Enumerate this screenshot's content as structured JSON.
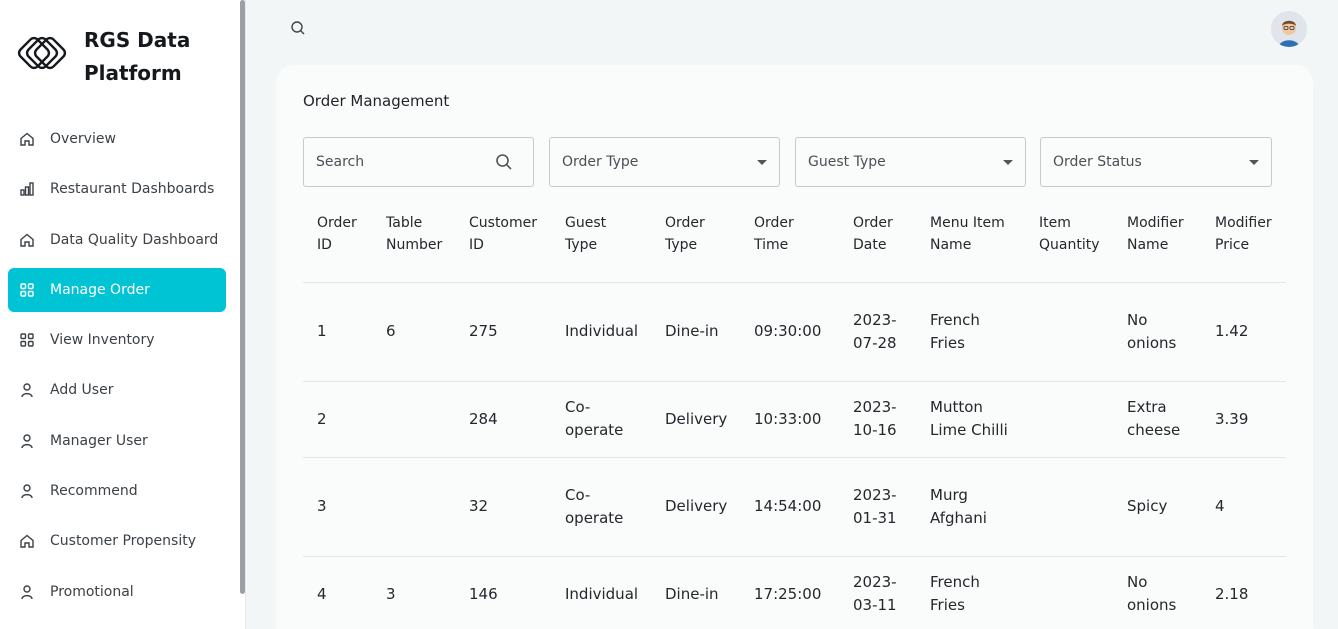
{
  "brand": {
    "line1": "RGS Data",
    "line2": "Platform"
  },
  "nav": [
    {
      "label": "Overview",
      "icon": "home-icon"
    },
    {
      "label": "Restaurant Dashboards",
      "icon": "bar-chart-icon"
    },
    {
      "label": "Data Quality Dashboard",
      "icon": "home-icon"
    },
    {
      "label": "Manage Order",
      "icon": "grid-icon",
      "active": true
    },
    {
      "label": "View Inventory",
      "icon": "grid-icon"
    },
    {
      "label": "Add User",
      "icon": "user-icon"
    },
    {
      "label": "Manager User",
      "icon": "user-icon"
    },
    {
      "label": "Recommend",
      "icon": "user-icon"
    },
    {
      "label": "Customer Propensity",
      "icon": "home-icon"
    },
    {
      "label": "Promotional",
      "icon": "user-icon"
    }
  ],
  "colors": {
    "accent": "#00c4d4"
  },
  "page": {
    "title": "Order Management"
  },
  "filters": {
    "search_placeholder": "Search",
    "order_type": "Order Type",
    "guest_type": "Guest Type",
    "order_status": "Order Status"
  },
  "table": {
    "headers": [
      [
        "Order",
        "ID"
      ],
      [
        "Table",
        "Number"
      ],
      [
        "Customer",
        "ID"
      ],
      [
        "Guest",
        "Type"
      ],
      [
        "Order",
        "Type"
      ],
      [
        "Order",
        "Time"
      ],
      [
        "Order",
        "Date"
      ],
      [
        "Menu Item",
        "Name"
      ],
      [
        "Item",
        "Quantity"
      ],
      [
        "Modifier",
        "Name"
      ],
      [
        "Modifier",
        "Price"
      ]
    ],
    "rows": [
      {
        "order_id": "1",
        "table_number": "6",
        "customer_id": "275",
        "guest_type": [
          "Individual"
        ],
        "order_type": "Dine-in",
        "order_time": "09:30:00",
        "order_date": [
          "2023-",
          "07-28"
        ],
        "menu_item": [
          "French",
          "Fries"
        ],
        "item_quantity": "",
        "modifier_name": [
          "No",
          "onions"
        ],
        "modifier_price": "1.42"
      },
      {
        "order_id": "2",
        "table_number": "",
        "customer_id": "284",
        "guest_type": [
          "Co-",
          "operate"
        ],
        "order_type": "Delivery",
        "order_time": "10:33:00",
        "order_date": [
          "2023-",
          "10-16"
        ],
        "menu_item": [
          "Mutton",
          "Lime Chilli"
        ],
        "item_quantity": "",
        "modifier_name": [
          "Extra",
          "cheese"
        ],
        "modifier_price": "3.39"
      },
      {
        "order_id": "3",
        "table_number": "",
        "customer_id": "32",
        "guest_type": [
          "Co-",
          "operate"
        ],
        "order_type": "Delivery",
        "order_time": "14:54:00",
        "order_date": [
          "2023-",
          "01-31"
        ],
        "menu_item": [
          "Murg",
          "Afghani"
        ],
        "item_quantity": "",
        "modifier_name": [
          "Spicy"
        ],
        "modifier_price": "4"
      },
      {
        "order_id": "4",
        "table_number": "3",
        "customer_id": "146",
        "guest_type": [
          "Individual"
        ],
        "order_type": "Dine-in",
        "order_time": "17:25:00",
        "order_date": [
          "2023-",
          "03-11"
        ],
        "menu_item": [
          "French",
          "Fries"
        ],
        "item_quantity": "",
        "modifier_name": [
          "No",
          "onions"
        ],
        "modifier_price": "2.18"
      }
    ]
  }
}
